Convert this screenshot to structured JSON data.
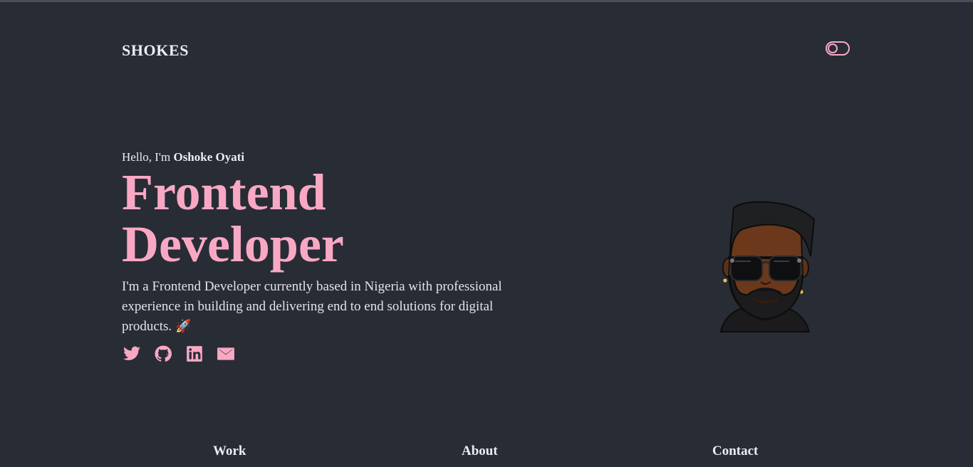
{
  "header": {
    "logo": "SHOKES",
    "theme_toggle_icon": "toggle-icon"
  },
  "hero": {
    "greeting_prefix": "Hello, I'm ",
    "name": "Oshoke Oyati",
    "title_line1": "Frontend",
    "title_line2": "Developer",
    "bio": "I'm a Frontend Developer currently based in Nigeria with professional experience in building and delivering end to end solutions for digital products.",
    "bio_emoji": "🚀",
    "avatar": "memoji-avatar"
  },
  "socials": [
    {
      "icon": "twitter-icon"
    },
    {
      "icon": "github-icon"
    },
    {
      "icon": "linkedin-icon"
    },
    {
      "icon": "mail-icon"
    }
  ],
  "nav": {
    "work": "Work",
    "about": "About",
    "contact": "Contact"
  },
  "colors": {
    "background": "#282c35",
    "accent": "#f9a8c4",
    "text": "#ececf2"
  }
}
